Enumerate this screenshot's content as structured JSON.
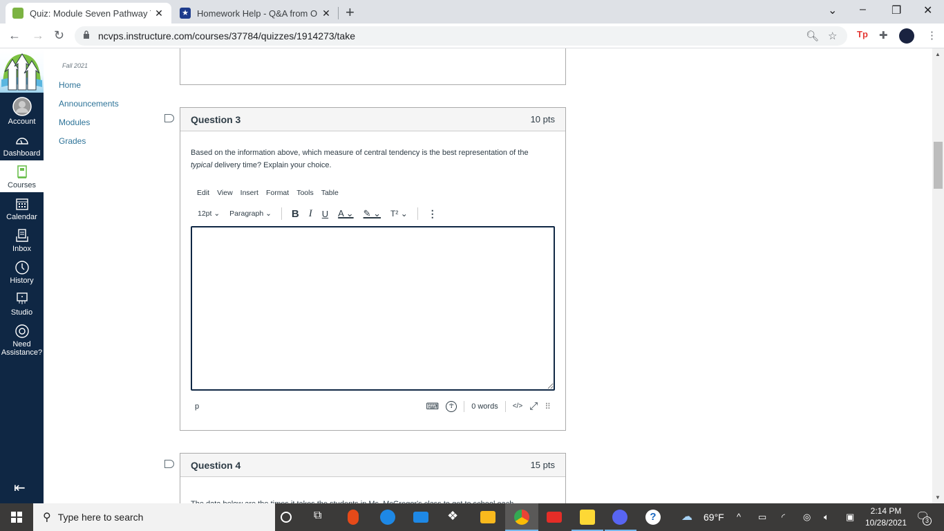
{
  "browser": {
    "tabs": [
      {
        "title": "Quiz: Module Seven Pathway Two",
        "active": true
      },
      {
        "title": "Homework Help - Q&A from Online",
        "active": false
      }
    ],
    "url": "ncvps.instructure.com/courses/37784/quizzes/1914273/take",
    "extensions": [
      "Tp",
      "puzzle",
      "avatar"
    ]
  },
  "global_nav": {
    "items": [
      {
        "label": "Account"
      },
      {
        "label": "Dashboard"
      },
      {
        "label": "Courses"
      },
      {
        "label": "Calendar"
      },
      {
        "label": "Inbox"
      },
      {
        "label": "History"
      },
      {
        "label": "Studio"
      },
      {
        "label": "Need Assistance?"
      }
    ]
  },
  "course_nav": {
    "term": "Fall 2021",
    "links": [
      "Home",
      "Announcements",
      "Modules",
      "Grades"
    ]
  },
  "questions": [
    {
      "name": "Question 3",
      "points": "10 pts",
      "text_before": "Based on the information above, which measure of central tendency is the best representation of the ",
      "text_italic": "typical",
      "text_after": " delivery time?  Explain your choice."
    },
    {
      "name": "Question 4",
      "points": "15 pts",
      "text_partial": "The data below are the times it takes the students in Ms. McGregor's class to get to school each"
    }
  ],
  "editor": {
    "menu": [
      "Edit",
      "View",
      "Insert",
      "Format",
      "Tools",
      "Table"
    ],
    "font_size": "12pt",
    "block_format": "Paragraph",
    "path": "p",
    "word_count": "0 words",
    "html_toggle": "</>",
    "value": ""
  },
  "taskbar": {
    "search_placeholder": "Type here to search",
    "weather": "69°F",
    "time": "2:14 PM",
    "date": "10/28/2021",
    "notifications": "3"
  }
}
